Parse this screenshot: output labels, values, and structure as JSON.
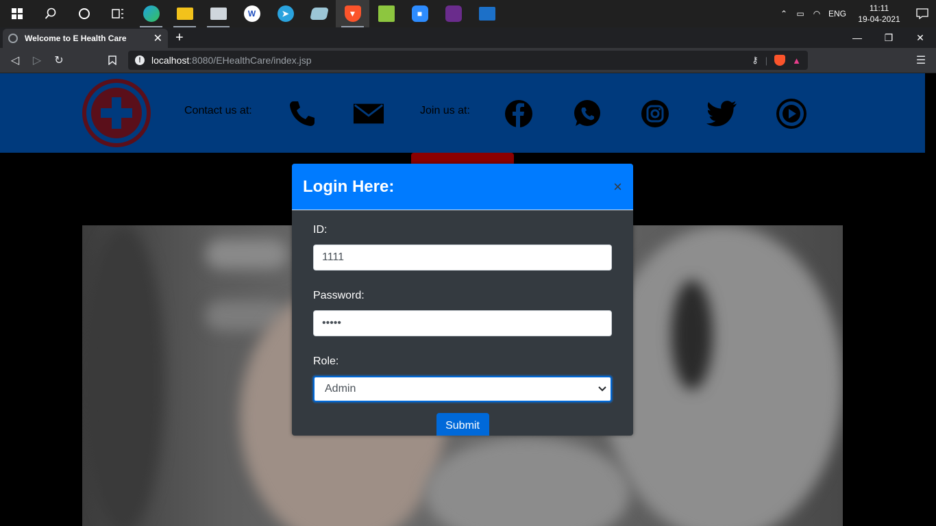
{
  "taskbar": {
    "apps": [
      {
        "name": "start-icon"
      },
      {
        "name": "search-icon"
      },
      {
        "name": "cortana-icon"
      },
      {
        "name": "task-view-icon"
      },
      {
        "name": "edge-icon",
        "color": "#1fa3e0"
      },
      {
        "name": "file-explorer-icon",
        "color": "#f2c21b"
      },
      {
        "name": "task-manager-icon",
        "color": "#cfd6dc"
      },
      {
        "name": "wps-icon",
        "color": "#ffffff"
      },
      {
        "name": "telegram-icon",
        "color": "#2aa3de"
      },
      {
        "name": "notes-icon",
        "color": "#9cc6d6"
      },
      {
        "name": "brave-icon",
        "color": "#fb542b"
      },
      {
        "name": "notepad-plus-icon",
        "color": "#8dc63f"
      },
      {
        "name": "zoom-icon",
        "color": "#2d8cff"
      },
      {
        "name": "game-icon",
        "color": "#6a2c8c"
      },
      {
        "name": "photos-icon",
        "color": "#1c70c8"
      }
    ],
    "tray": {
      "language": "ENG",
      "time": "11:11",
      "date": "19-04-2021"
    }
  },
  "browser": {
    "tab_title": "Welcome to E Health Care",
    "tab_close": "✕",
    "new_tab": "+",
    "url_host": "localhost",
    "url_rest": ":8080/EHealthCare/index.jsp"
  },
  "header": {
    "contact_label": "Contact us at:",
    "join_label": "Join us at:"
  },
  "modal": {
    "title": "Login Here:",
    "close": "×",
    "id_label": "ID:",
    "id_value": "1111",
    "password_label": "Password:",
    "password_value": "•••••",
    "role_label": "Role:",
    "role_value": "Admin",
    "submit_label": "Submit"
  },
  "colors": {
    "header_bg": "#003a7d",
    "modal_header": "#007bff",
    "modal_body": "#343a40",
    "button": "#0069d9",
    "logo": "#5a0f1a"
  }
}
